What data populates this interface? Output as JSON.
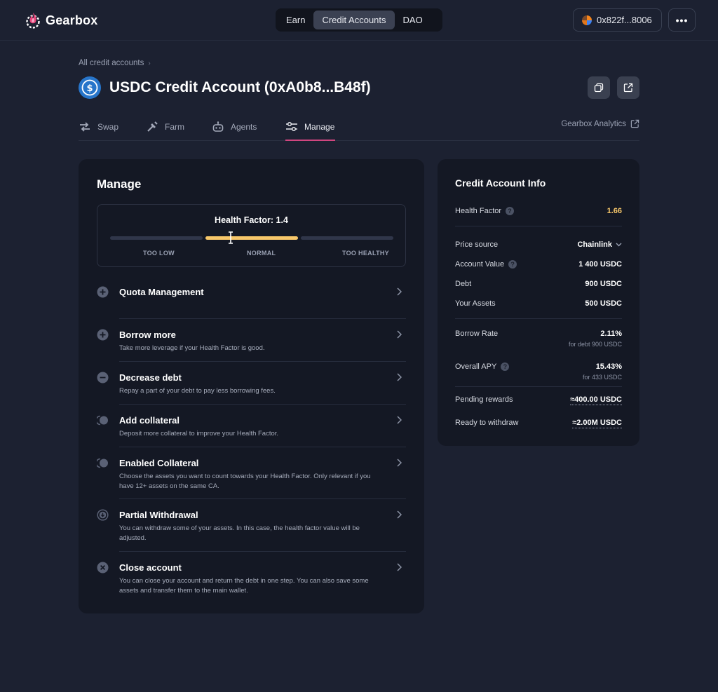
{
  "app": {
    "brand": "Gearbox"
  },
  "nav": {
    "tabs": [
      "Earn",
      "Credit Accounts",
      "DAO"
    ],
    "active_tab": "Credit Accounts"
  },
  "wallet": {
    "address": "0x822f...8006"
  },
  "breadcrumb": {
    "label": "All credit accounts"
  },
  "page": {
    "title": "USDC Credit Account (0xA0b8...B48f)"
  },
  "tabs": {
    "items": [
      {
        "label": "Swap",
        "icon": "swap-icon"
      },
      {
        "label": "Farm",
        "icon": "farm-icon"
      },
      {
        "label": "Agents",
        "icon": "robot-icon"
      },
      {
        "label": "Manage",
        "icon": "sliders-icon"
      }
    ],
    "active": "Manage",
    "analytics_label": "Gearbox Analytics"
  },
  "manage": {
    "title": "Manage",
    "health_factor": {
      "label": "Health Factor: 1.4",
      "zones": [
        "TOO LOW",
        "NORMAL",
        "TOO HEALTHY"
      ],
      "active_zone": "NORMAL"
    },
    "items": [
      {
        "title": "Quota Management",
        "desc": "",
        "icon": "plus-circle-icon"
      },
      {
        "title": "Borrow more",
        "desc": "Take more leverage if your Health Factor is good.",
        "icon": "plus-circle-icon"
      },
      {
        "title": "Decrease debt",
        "desc": "Repay a part of your debt to pay less borrowing fees.",
        "icon": "minus-circle-icon"
      },
      {
        "title": "Add collateral",
        "desc": "Deposit more collateral to improve your Health Factor.",
        "icon": "coins-icon"
      },
      {
        "title": "Enabled Collateral",
        "desc": "Choose the assets you want to count towards your Health Factor. Only relevant if you have 12+ assets on the same CA.",
        "icon": "coins-icon"
      },
      {
        "title": "Partial Withdrawal",
        "desc": "You can withdraw some of your assets. In this case, the health factor value will be adjusted.",
        "icon": "download-circle-icon"
      },
      {
        "title": "Close account",
        "desc": "You can close your account and return the debt in one step. You can also save some assets and transfer them to the main wallet.",
        "icon": "close-circle-icon"
      }
    ]
  },
  "info": {
    "title": "Credit Account Info",
    "health_factor": {
      "label": "Health Factor",
      "value": "1.66",
      "color": "#f7c76a"
    },
    "price_source": {
      "label": "Price source",
      "value": "Chainlink"
    },
    "account_value": {
      "label": "Account Value",
      "value": "1 400 USDC"
    },
    "debt": {
      "label": "Debt",
      "value": "900 USDC"
    },
    "your_assets": {
      "label": "Your Assets",
      "value": "500 USDC"
    },
    "borrow_rate": {
      "label": "Borrow Rate",
      "value": "2.11%",
      "sub": "for debt 900 USDC"
    },
    "overall_apy": {
      "label": "Overall APY",
      "value": "15.43%",
      "sub": "for 433 USDC"
    },
    "pending_rewards": {
      "label": "Pending rewards",
      "value": "≈400.00 USDC"
    },
    "ready_to_withdraw": {
      "label": "Ready to withdraw",
      "value": "≈2.00M USDC"
    }
  },
  "colors": {
    "accent_tab": "#d0467f",
    "hf_normal": "#f7c76a",
    "usdc": "#2775ca"
  }
}
